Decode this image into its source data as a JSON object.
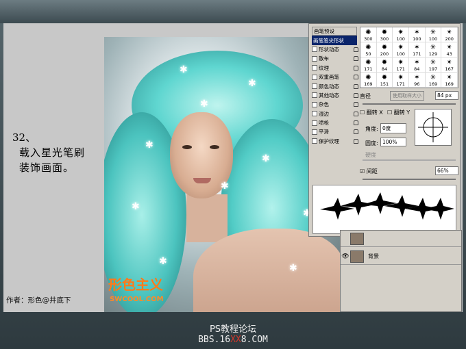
{
  "tutorial": {
    "step_number": "32、",
    "step_line1": "载入星光笔刷",
    "step_line2": "装饰画面。",
    "author": "作者：形色@井底下"
  },
  "watermark": {
    "text": "形色主义",
    "sub": "SWCOOL.COM"
  },
  "brush_panel": {
    "sidebar": [
      {
        "label": "画笔预设",
        "selected": false,
        "header": true
      },
      {
        "label": "画笔笔尖形状",
        "selected": true
      },
      {
        "label": "形状动态",
        "checked": false
      },
      {
        "label": "散布",
        "checked": false
      },
      {
        "label": "纹理",
        "checked": false
      },
      {
        "label": "双重画笔",
        "checked": false
      },
      {
        "label": "颜色动态",
        "checked": false
      },
      {
        "label": "其他动态",
        "checked": false
      },
      {
        "label": "杂色",
        "checked": false
      },
      {
        "label": "湿边",
        "checked": false
      },
      {
        "label": "喷枪",
        "checked": false
      },
      {
        "label": "平滑",
        "checked": false
      },
      {
        "label": "保护纹理",
        "checked": false
      }
    ],
    "presets": [
      "300",
      "300",
      "100",
      "100",
      "100",
      "200",
      "50",
      "200",
      "100",
      "171",
      "129",
      "43",
      "171",
      "84",
      "171",
      "84",
      "197",
      "167",
      "169",
      "151",
      "171",
      "96",
      "169",
      "169"
    ],
    "diameter_label": "直径",
    "use_sample_label": "使用取样大小",
    "diameter_value": "84 px",
    "flip_x_label": "翻转 X",
    "flip_y_label": "翻转 Y",
    "angle_label": "角度:",
    "angle_value": "0度",
    "roundness_label": "圆度:",
    "roundness_value": "100%",
    "hardness_label": "硬度",
    "spacing_label": "间距",
    "spacing_checked": true,
    "spacing_value": "66%"
  },
  "layers_panel": {
    "layers": [
      {
        "name": ""
      },
      {
        "name": "背景"
      }
    ]
  },
  "footer": {
    "line1": "PS教程论坛",
    "line2_prefix": "BBS.16",
    "line2_xx": "XX",
    "line2_suffix": "8.COM"
  },
  "colors": {
    "accent": "#0a246a",
    "watermark": "#ff7a1a",
    "hair": "#5fd6d0"
  }
}
